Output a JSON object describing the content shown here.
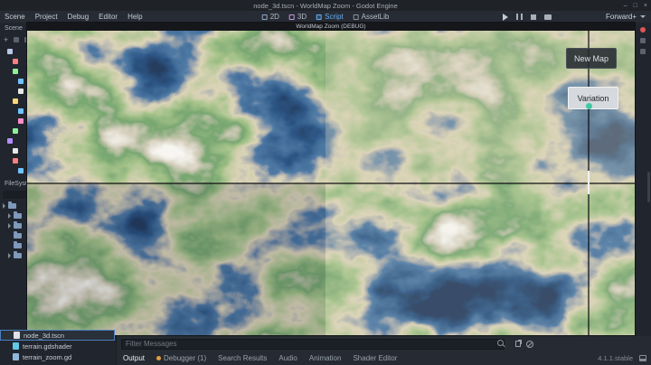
{
  "titlebar": {
    "title": "node_3d.tscn - WorldMap Zoom - Godot Engine"
  },
  "menubar": {
    "items": [
      "Scene",
      "Project",
      "Debug",
      "Editor",
      "Help"
    ],
    "workspaces": [
      "2D",
      "3D",
      "Script",
      "AssetLib"
    ],
    "renderer": "Forward+"
  },
  "scene_dock": {
    "title": "Scene"
  },
  "filesystem_dock": {
    "title": "FileSystem",
    "files": [
      "node_3d.tscn",
      "terrain.gdshader",
      "terrain_zoom.gd"
    ]
  },
  "game_window": {
    "title": "WorldMap Zoom (DEBUG)",
    "new_map_label": "New Map",
    "variation_label": "Variation"
  },
  "bottom_panel": {
    "filter_placeholder": "Filter Messages",
    "tabs": [
      "Output",
      "Debugger (1)",
      "Search Results",
      "Audio",
      "Animation",
      "Shader Editor"
    ],
    "version": "4.1.1.stable"
  },
  "colors": {
    "accent": "#66b0f4",
    "debugger_dot": "#df9f3e",
    "variation_dot": "#3fc9a4"
  }
}
